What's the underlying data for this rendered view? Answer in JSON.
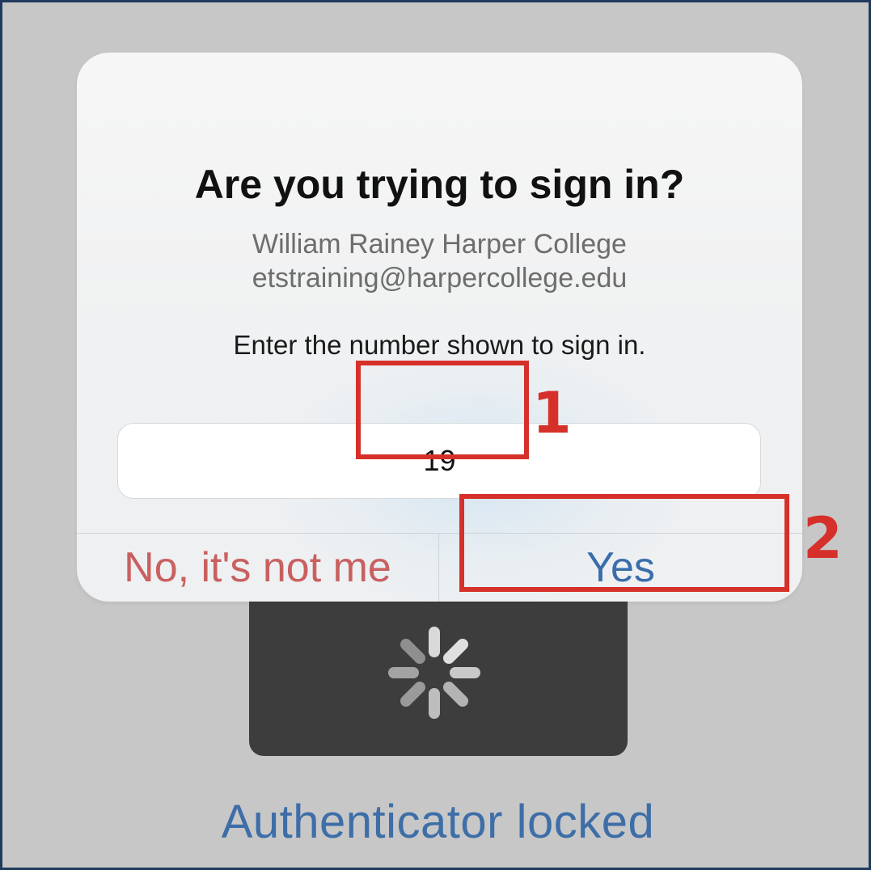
{
  "dialog": {
    "title": "Are you trying to sign in?",
    "organization": "William Rainey Harper College",
    "account": "etstraining@harpercollege.edu",
    "instruction": "Enter the number shown to sign in.",
    "number_value": "19",
    "deny_label": "No, it's not me",
    "approve_label": "Yes"
  },
  "background": {
    "status_text": "Authenticator locked",
    "spinner_icon": "loading-spinner-icon"
  },
  "annotations": {
    "callout_1": "1",
    "callout_2": "2",
    "color": "#d6302a"
  },
  "colors": {
    "deny": "#c96060",
    "approve": "#3b6dab",
    "locked_text": "#3d6ea8"
  }
}
